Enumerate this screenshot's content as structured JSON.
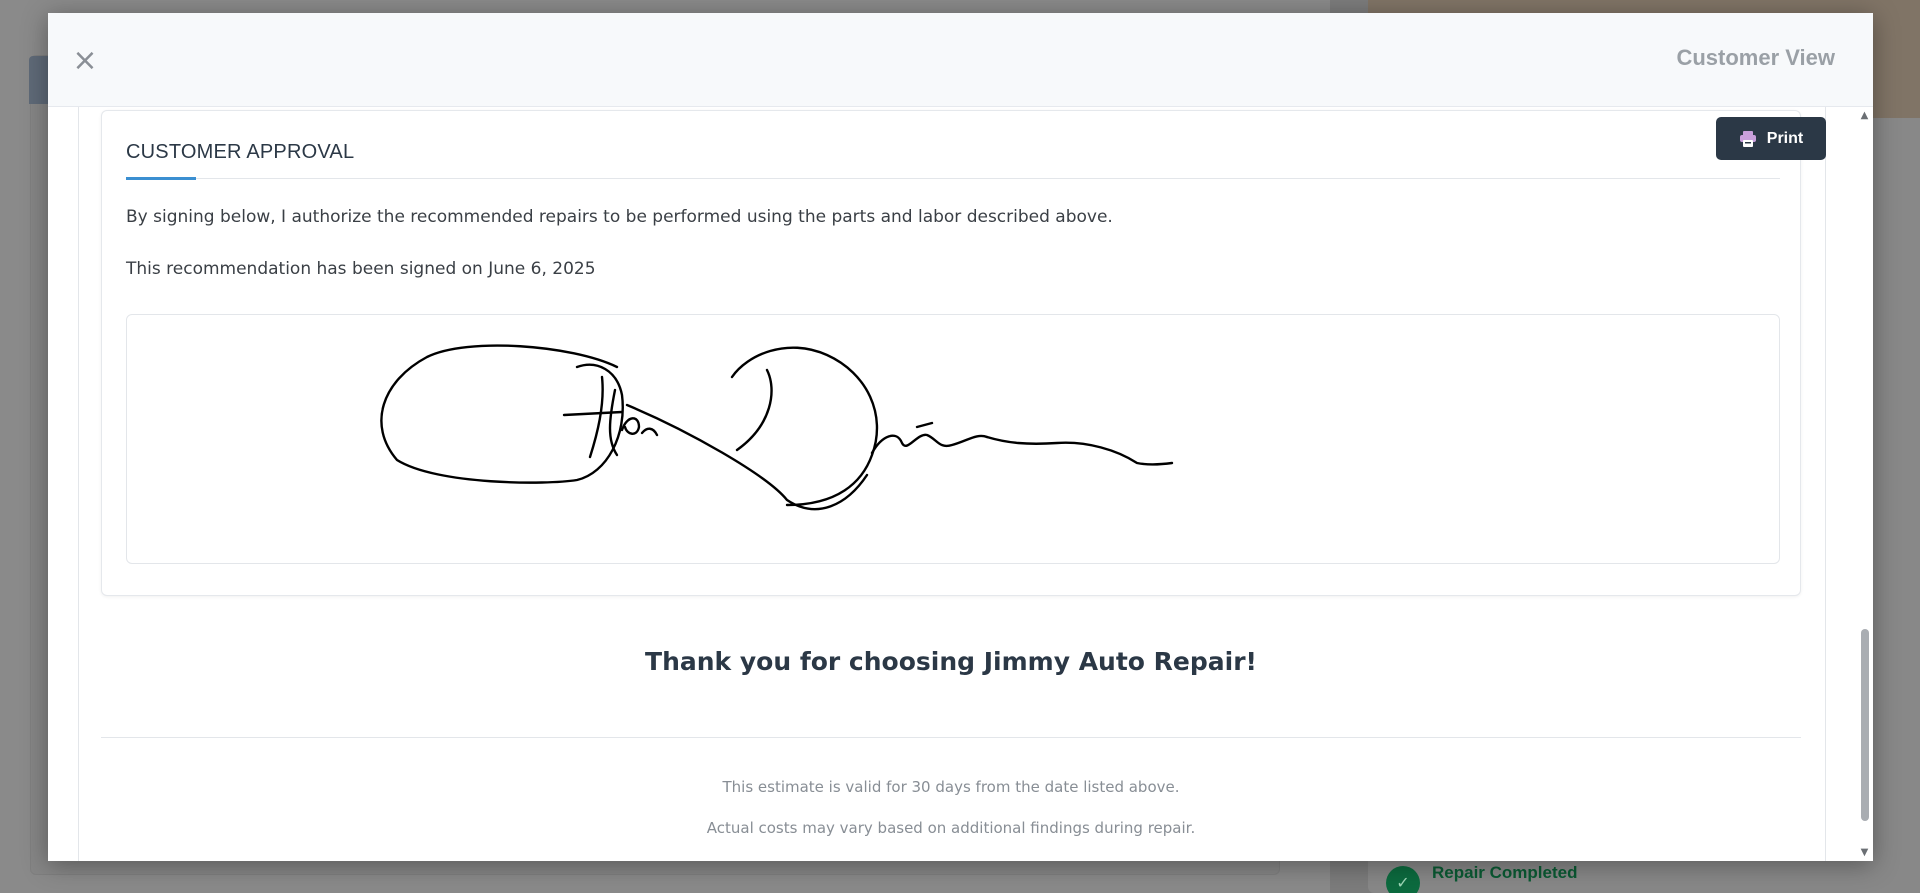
{
  "background": {
    "status_label": "Repair Completed",
    "status_icon": "check-circle-icon"
  },
  "modal": {
    "title": "Customer View",
    "close_glyph": "×"
  },
  "approval": {
    "heading": "CUSTOMER APPROVAL",
    "authorization": "By signing below, I authorize the recommended repairs to be performed using the parts and labor described above.",
    "signed_notice": "This recommendation has been signed on June 6, 2025"
  },
  "toolbar": {
    "print_label": "Print",
    "print_icon": "printer-icon"
  },
  "footer": {
    "thank_you": "Thank you for choosing Jimmy Auto Repair!",
    "validity": "This estimate is valid for 30 days from the date listed above.",
    "disclaimer": "Actual costs may vary based on additional findings during repair."
  },
  "colors": {
    "primary_dark": "#2b3846",
    "accent_blue": "#3b8fd1",
    "muted_text": "#888e95",
    "success_green": "#0c6b3f"
  }
}
